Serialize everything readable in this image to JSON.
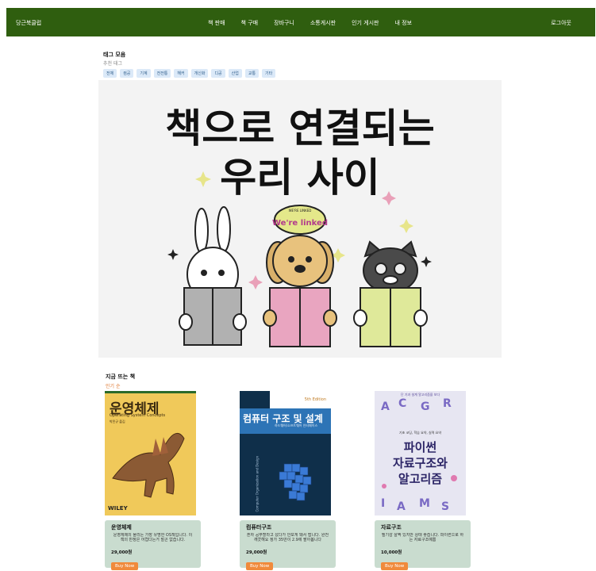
{
  "nav": {
    "brand": "당근북클럽",
    "items": [
      "책 판매",
      "책 구매",
      "장바구니",
      "소통게시판",
      "인기 게시판",
      "내 정보"
    ],
    "login": "로그아웃"
  },
  "tags": {
    "title": "태그 모음",
    "subtitle": "추천 태그",
    "items": [
      "전체",
      "컴공",
      "기계",
      "전전통",
      "해커",
      "개신화",
      "디공",
      "산업",
      "교통",
      "기타"
    ]
  },
  "hero": {
    "line1": "책으로 연결되는",
    "line2": "우리 사이",
    "badge_small": "WE'RE LINKED",
    "badge": "We're linked"
  },
  "trending": {
    "title": "지금 뜨는 책",
    "subtitle": "인기 순"
  },
  "books": [
    {
      "title": "운영체제",
      "desc": "운영체제의 몰리는 가장 유명한 OS책입니다. 이 책의 반정은 어렵다는거 말곤 없습니다.",
      "price": "29,000원",
      "buy": "Buy Now",
      "cover_title": "운영체제",
      "cover_sub": "Operating System Concepts",
      "cover_author": "박민규 옮김",
      "cover_publisher": "WILEY"
    },
    {
      "title": "컴퓨터구조",
      "desc": "혼자 공부할라고 샀다가 안보게 돼서 팝니다. 완전 깨끗해요 정가 35만이 2.9에 팔아봅니다",
      "price": "29,000원",
      "buy": "Buy Now",
      "cover_title": "컴퓨터 구조 및 설계",
      "cover_sub": "하드웨어/소프트웨어 인터페이스",
      "cover_edition": "5th Edition",
      "cover_spine": "Computer Organization and Design"
    },
    {
      "title": "자료구조",
      "desc": "필기감 살짝 있지만 상태 좋습니다. 파이썬으로 하는 자료구조예쁨",
      "price": "10,000원",
      "buy": "Buy Now",
      "cover_top": "단 기과 설계 알고리즘을 보다",
      "cover_sub": "기초 코딩, 학습 요약, 실력 요약",
      "cover_title_1": "파이썬",
      "cover_title_2": "자료구조와",
      "cover_title_3": "알고리즘"
    }
  ],
  "colors": {
    "nav_bg": "#2f5e0f",
    "card_bg": "#c9dccf",
    "buy_bg": "#f08a3c",
    "tag_bg": "#dbe9f8"
  }
}
